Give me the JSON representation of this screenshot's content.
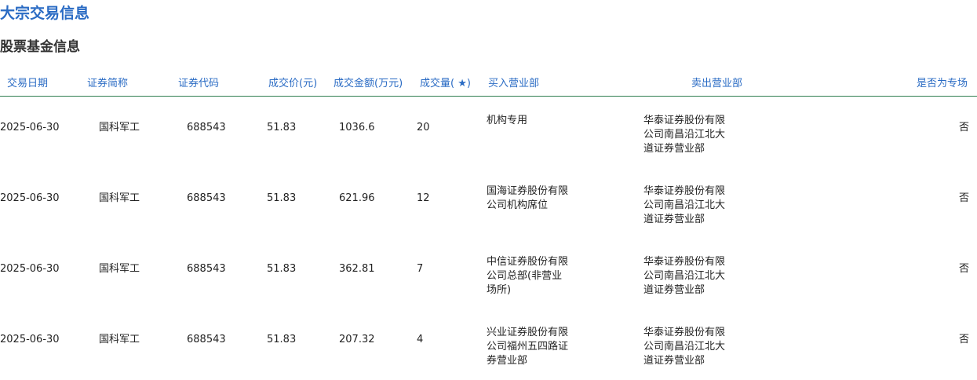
{
  "page": {
    "title": "大宗交易信息",
    "section_title": "股票基金信息"
  },
  "table": {
    "headers": [
      "交易日期",
      "证券简称",
      "证券代码",
      "成交价(元)",
      "成交金额(万元)",
      "成交量( ★)",
      "买入营业部",
      "卖出营业部",
      "是否为专场"
    ],
    "rows": [
      {
        "date": "2025-06-30",
        "name": "国科军工",
        "code": "688543",
        "price": "51.83",
        "amount": "1036.6",
        "volume": "20",
        "buyer": [
          "机构专用"
        ],
        "seller": [
          "华泰证券股份有限",
          "公司南昌沿江北大",
          "道证券营业部"
        ],
        "special": "否"
      },
      {
        "date": "2025-06-30",
        "name": "国科军工",
        "code": "688543",
        "price": "51.83",
        "amount": "621.96",
        "volume": "12",
        "buyer": [
          "国海证券股份有限",
          "公司机构席位"
        ],
        "seller": [
          "华泰证券股份有限",
          "公司南昌沿江北大",
          "道证券营业部"
        ],
        "special": "否"
      },
      {
        "date": "2025-06-30",
        "name": "国科军工",
        "code": "688543",
        "price": "51.83",
        "amount": "362.81",
        "volume": "7",
        "buyer": [
          "中信证券股份有限",
          "公司总部(非营业",
          "场所)"
        ],
        "seller": [
          "华泰证券股份有限",
          "公司南昌沿江北大",
          "道证券营业部"
        ],
        "special": "否"
      },
      {
        "date": "2025-06-30",
        "name": "国科军工",
        "code": "688543",
        "price": "51.83",
        "amount": "207.32",
        "volume": "4",
        "buyer": [
          "兴业证券股份有限",
          "公司福州五四路证",
          "券营业部"
        ],
        "seller": [
          "华泰证券股份有限",
          "公司南昌沿江北大",
          "道证券营业部"
        ],
        "special": "否"
      }
    ]
  },
  "colors": {
    "title": "#2a6bc4",
    "header_text": "#2a6bc4",
    "header_rule": "#2e7d4f",
    "body_text": "#222222"
  }
}
